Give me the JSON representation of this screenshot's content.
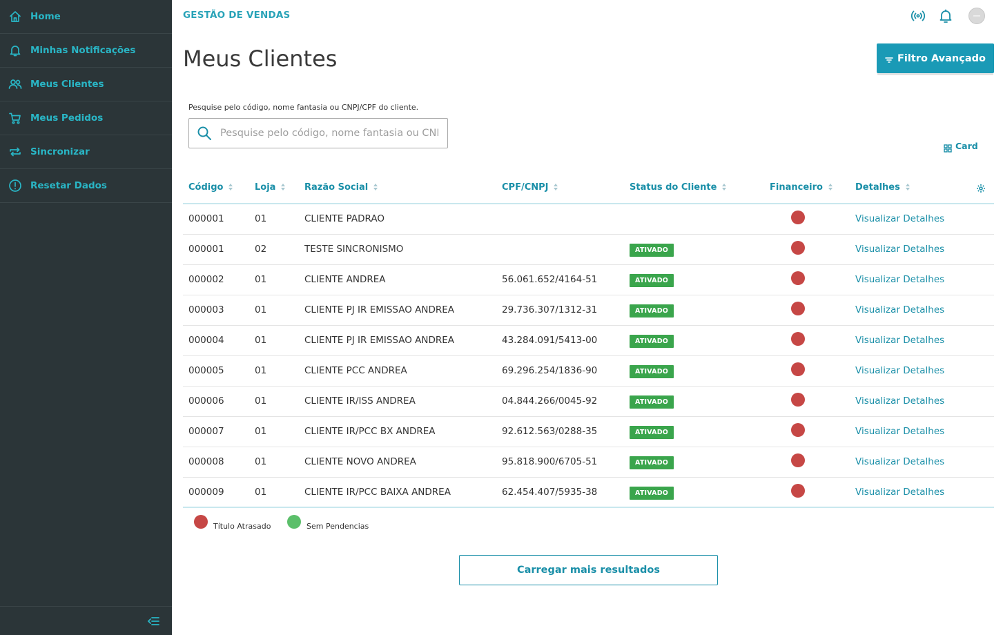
{
  "sidebar": {
    "items": [
      {
        "label": "Home",
        "icon": "home-icon"
      },
      {
        "label": "Minhas Notificações",
        "icon": "bell-icon"
      },
      {
        "label": "Meus Clientes",
        "icon": "users-icon"
      },
      {
        "label": "Meus Pedidos",
        "icon": "cart-icon"
      },
      {
        "label": "Sincronizar",
        "icon": "sync-icon"
      },
      {
        "label": "Resetar Dados",
        "icon": "info-icon"
      }
    ],
    "accent_color": "#29b6c6",
    "background": "#2b3538"
  },
  "header": {
    "app_title": "GESTÃO DE VENDAS",
    "icons": [
      "connectivity-icon",
      "bell-icon",
      "avatar"
    ]
  },
  "page": {
    "title": "Meus Clientes",
    "filter_button": "Filtro Avançado"
  },
  "search": {
    "hint": "Pesquise pelo código, nome fantasia ou CNPJ/CPF do cliente.",
    "placeholder": "Pesquise pelo código, nome fantasia ou CNPJ/CPF do cliente.",
    "value": ""
  },
  "view_toggle": {
    "label": "Card",
    "icon": "grid-icon"
  },
  "table": {
    "columns": [
      "Código",
      "Loja",
      "Razão Social",
      "CPF/CNPJ",
      "Status do Cliente",
      "Financeiro",
      "Detalhes"
    ],
    "rows": [
      {
        "codigo": "000001",
        "loja": "01",
        "razao": "CLIENTE PADRAO",
        "cnpj": "",
        "status": "",
        "financeiro": "Título Atrasado",
        "detalhes": "Visualizar Detalhes"
      },
      {
        "codigo": "000001",
        "loja": "02",
        "razao": "TESTE SINCRONISMO",
        "cnpj": "",
        "status": "ATIVADO",
        "financeiro": "Título Atrasado",
        "detalhes": "Visualizar Detalhes"
      },
      {
        "codigo": "000002",
        "loja": "01",
        "razao": "CLIENTE ANDREA",
        "cnpj": "56.061.652/4164-51",
        "status": "ATIVADO",
        "financeiro": "Título Atrasado",
        "detalhes": "Visualizar Detalhes"
      },
      {
        "codigo": "000003",
        "loja": "01",
        "razao": "CLIENTE PJ IR EMISSAO ANDREA",
        "cnpj": "29.736.307/1312-31",
        "status": "ATIVADO",
        "financeiro": "Título Atrasado",
        "detalhes": "Visualizar Detalhes"
      },
      {
        "codigo": "000004",
        "loja": "01",
        "razao": "CLIENTE PJ IR EMISSAO ANDREA",
        "cnpj": "43.284.091/5413-00",
        "status": "ATIVADO",
        "financeiro": "Título Atrasado",
        "detalhes": "Visualizar Detalhes"
      },
      {
        "codigo": "000005",
        "loja": "01",
        "razao": "CLIENTE PCC ANDREA",
        "cnpj": "69.296.254/1836-90",
        "status": "ATIVADO",
        "financeiro": "Título Atrasado",
        "detalhes": "Visualizar Detalhes"
      },
      {
        "codigo": "000006",
        "loja": "01",
        "razao": "CLIENTE IR/ISS ANDREA",
        "cnpj": "04.844.266/0045-92",
        "status": "ATIVADO",
        "financeiro": "Título Atrasado",
        "detalhes": "Visualizar Detalhes"
      },
      {
        "codigo": "000007",
        "loja": "01",
        "razao": "CLIENTE IR/PCC BX ANDREA",
        "cnpj": "92.612.563/0288-35",
        "status": "ATIVADO",
        "financeiro": "Título Atrasado",
        "detalhes": "Visualizar Detalhes"
      },
      {
        "codigo": "000008",
        "loja": "01",
        "razao": "CLIENTE NOVO ANDREA",
        "cnpj": "95.818.900/6705-51",
        "status": "ATIVADO",
        "financeiro": "Título Atrasado",
        "detalhes": "Visualizar Detalhes"
      },
      {
        "codigo": "000009",
        "loja": "01",
        "razao": "CLIENTE IR/PCC BAIXA ANDREA",
        "cnpj": "62.454.407/5935-38",
        "status": "ATIVADO",
        "financeiro": "Título Atrasado",
        "detalhes": "Visualizar Detalhes"
      }
    ]
  },
  "legend": [
    {
      "label": "Título Atrasado",
      "color": "#c64745"
    },
    {
      "label": "Sem Pendencias",
      "color": "#5bbf6a"
    }
  ],
  "colors": {
    "primary": "#1a9ab6",
    "link": "#1a8fa8",
    "status_active": "#3aa54c",
    "overdue": "#c64745"
  },
  "load_more": "Carregar mais resultados"
}
